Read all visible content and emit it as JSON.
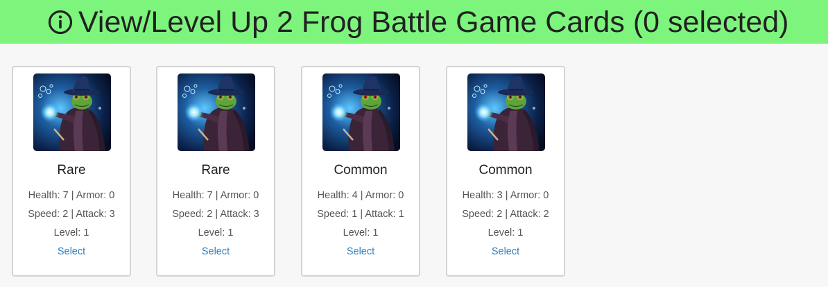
{
  "header": {
    "title": "View/Level Up 2 Frog Battle Game Cards (0 selected)",
    "icon": "info-circle-icon",
    "background": "#7df57d"
  },
  "cards": [
    {
      "rarity": "Rare",
      "stats_line1": "Health: 7 | Armor: 0",
      "stats_line2": "Speed: 2 | Attack: 3",
      "level": "Level: 1",
      "select_label": "Select"
    },
    {
      "rarity": "Rare",
      "stats_line1": "Health: 7 | Armor: 0",
      "stats_line2": "Speed: 2 | Attack: 3",
      "level": "Level: 1",
      "select_label": "Select"
    },
    {
      "rarity": "Common",
      "stats_line1": "Health: 4 | Armor: 0",
      "stats_line2": "Speed: 1 | Attack: 1",
      "level": "Level: 1",
      "select_label": "Select"
    },
    {
      "rarity": "Common",
      "stats_line1": "Health: 3 | Armor: 0",
      "stats_line2": "Speed: 2 | Attack: 2",
      "level": "Level: 1",
      "select_label": "Select"
    }
  ],
  "colors": {
    "link": "#2f7fbf",
    "card_border": "#d4d4d4"
  }
}
